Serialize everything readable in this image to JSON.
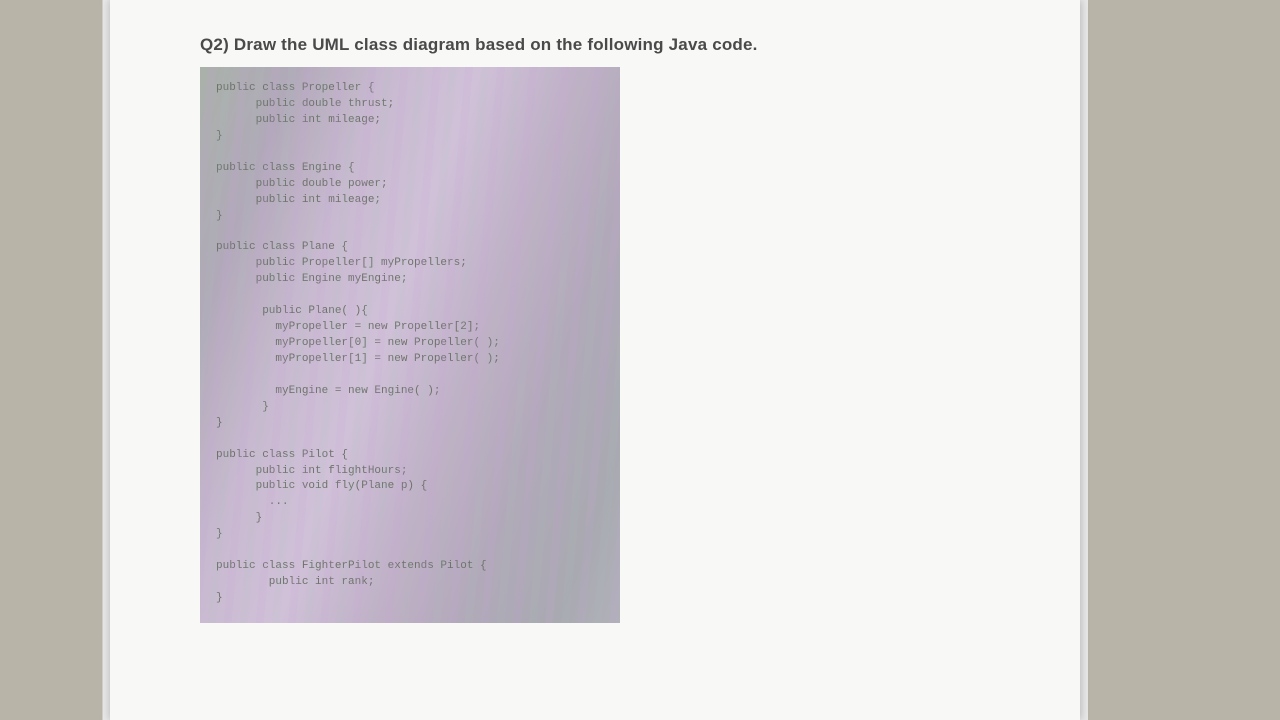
{
  "question": {
    "number": "Q2)",
    "text": "Draw the UML class diagram based on the following Java code."
  },
  "code": "public class Propeller {\n      public double thrust;\n      public int mileage;\n}\n\npublic class Engine {\n      public double power;\n      public int mileage;\n}\n\npublic class Plane {\n      public Propeller[] myPropellers;\n      public Engine myEngine;\n\n       public Plane( ){\n         myPropeller = new Propeller[2];\n         myPropeller[0] = new Propeller( );\n         myPropeller[1] = new Propeller( );\n\n         myEngine = new Engine( );\n       }\n}\n\npublic class Pilot {\n      public int flightHours;\n      public void fly(Plane p) {\n        ...\n      }\n}\n\npublic class FighterPilot extends Pilot {\n        public int rank;\n}"
}
